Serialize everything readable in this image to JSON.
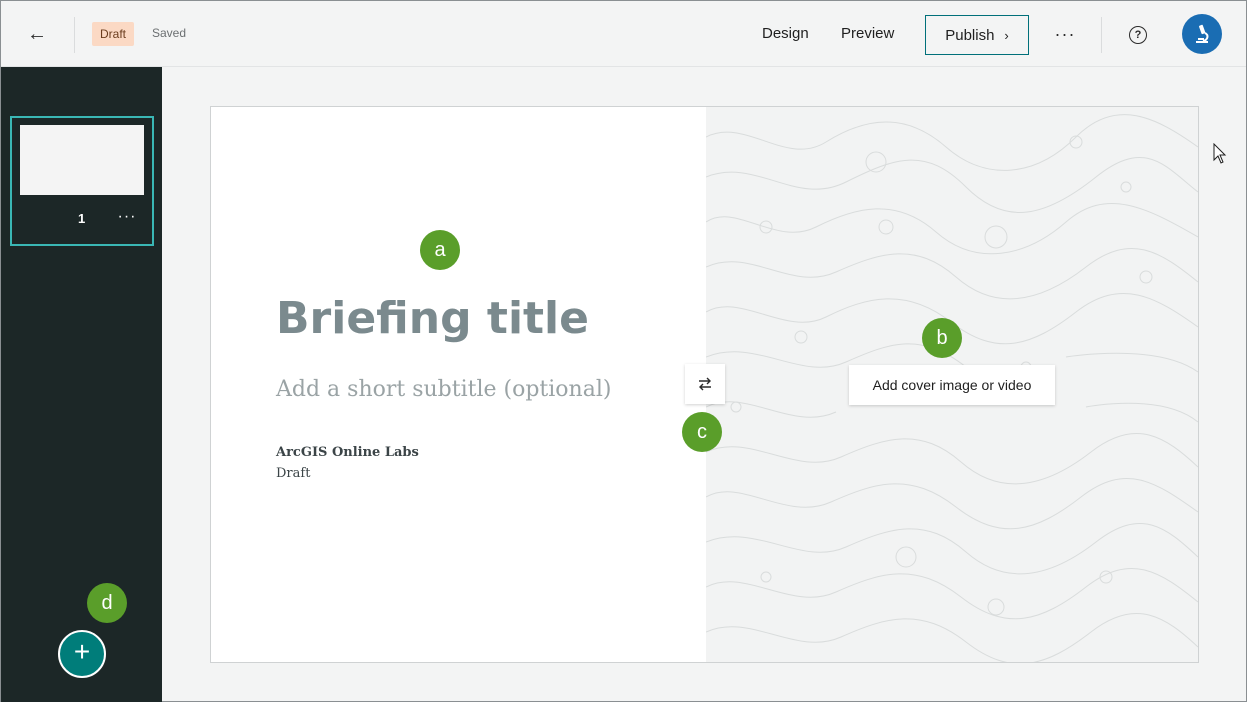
{
  "header": {
    "back_icon": "arrow-left-icon",
    "draft_badge": "Draft",
    "saved_text": "Saved",
    "nav": {
      "design": "Design",
      "preview": "Preview"
    },
    "publish_label": "Publish",
    "more_icon": "more-horizontal-icon",
    "help_icon": "question-circle-icon",
    "avatar_icon": "microscope-icon"
  },
  "sidebar": {
    "slides": [
      {
        "number": "1"
      }
    ],
    "add_slide_icon": "plus-icon"
  },
  "canvas": {
    "title": "Briefing title",
    "subtitle_placeholder": "Add a short subtitle (optional)",
    "author": "ArcGIS Online Labs",
    "status": "Draft",
    "cover_button": "Add cover image or video",
    "swap_icon": "swap-arrows-icon"
  },
  "markers": {
    "a": "a",
    "b": "b",
    "c": "c",
    "d": "d"
  },
  "colors": {
    "accent_teal": "#007d7a",
    "publish_border": "#00707a",
    "sidebar_bg": "#1c2727",
    "draft_badge_bg": "#fbd9c4",
    "marker_green": "#5a9e2a",
    "avatar_blue": "#1a6db3"
  }
}
